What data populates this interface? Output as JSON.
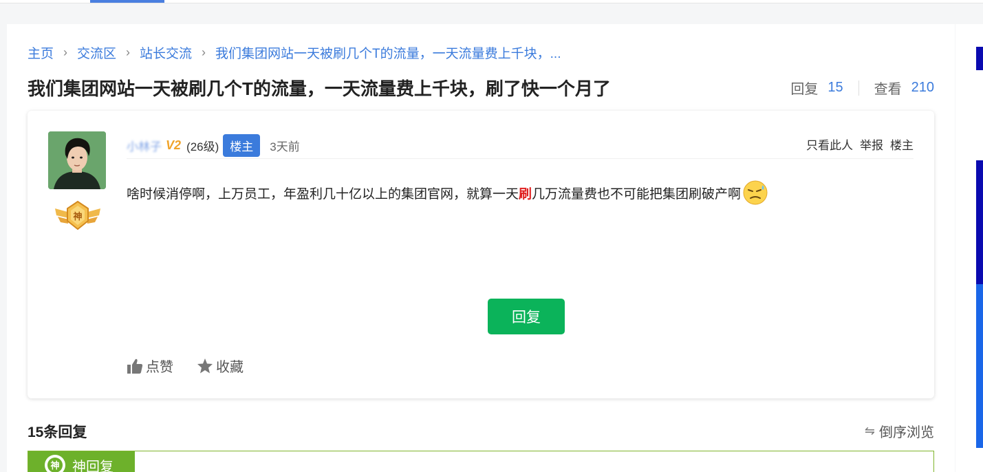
{
  "breadcrumb": {
    "items": [
      "主页",
      "交流区",
      "站长交流",
      "我们集团网站一天被刷几个T的流量，一天流量费上千块，..."
    ]
  },
  "thread": {
    "title": "我们集团网站一天被刷几个T的流量，一天流量费上千块，刷了快一个月了",
    "replies_label": "回复",
    "replies_count": "15",
    "views_label": "查看",
    "views_count": "210"
  },
  "post": {
    "username": "小林子",
    "vip_badge": "V2",
    "level": "(26级)",
    "owner_badge": "楼主",
    "time": "3天前",
    "actions": [
      "只看此人",
      "举报",
      "楼主"
    ],
    "content_before": "啥时候消停啊，上万员工，年盈利几十亿以上的集团官网，就算一天",
    "content_highlight": "刷",
    "content_after": "几万流量费也不可能把集团刷破产啊",
    "medal_label": "神",
    "reply_button": "回复",
    "like_label": "点赞",
    "favorite_label": "收藏"
  },
  "replies": {
    "count_label": "15条回复",
    "reverse_label": "倒序浏览",
    "god_reply_label": "神回复",
    "god_reply_icon_label": "神"
  },
  "colors": {
    "link": "#3b7bdc",
    "accent_green": "#0bb35a",
    "god_green": "#6db12b",
    "highlight_red": "#e02020"
  }
}
